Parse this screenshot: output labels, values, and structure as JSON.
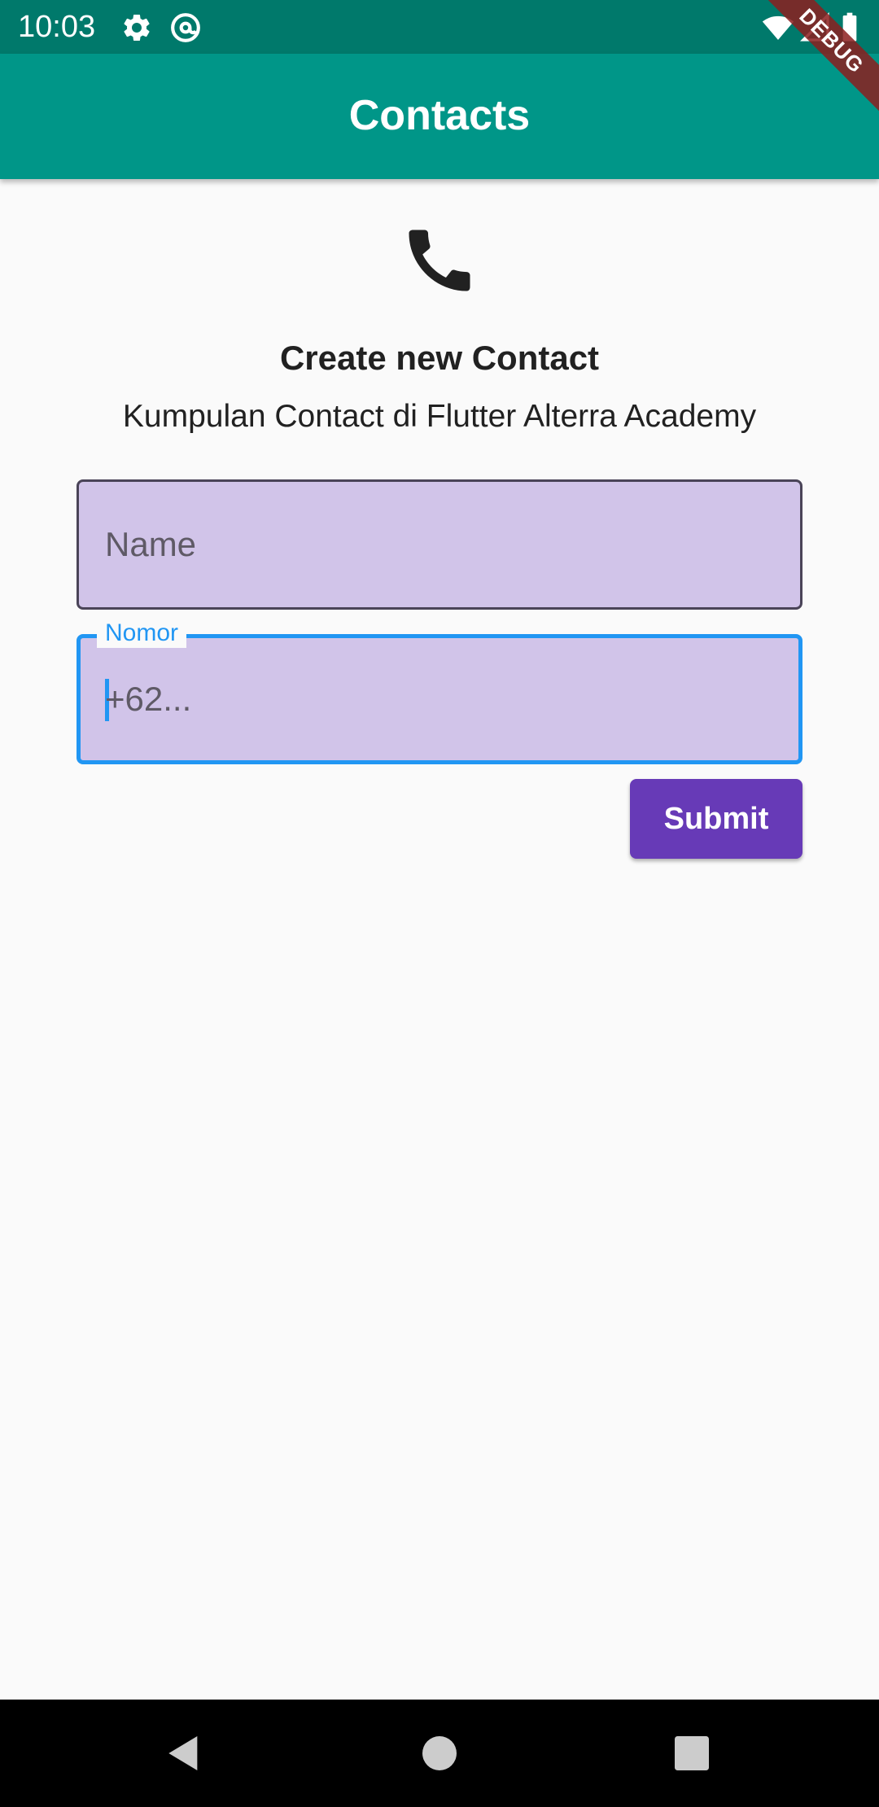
{
  "status_bar": {
    "time": "10:03",
    "icons": [
      "gear-icon",
      "at-sign-icon",
      "wifi-icon",
      "signal-icon",
      "battery-icon"
    ]
  },
  "debug_banner": "DEBUG",
  "app_bar": {
    "title": "Contacts"
  },
  "main": {
    "icon": "phone-icon",
    "heading": "Create new Contact",
    "subheading": "Kumpulan Contact di Flutter Alterra Academy",
    "name_field": {
      "placeholder": "Name",
      "value": ""
    },
    "nomor_field": {
      "label": "Nomor",
      "placeholder": "+62...",
      "value": ""
    },
    "submit_label": "Submit"
  },
  "nav_bar": {
    "buttons": [
      "back-icon",
      "home-icon",
      "recents-icon"
    ]
  },
  "colors": {
    "status_bar": "#00796b",
    "app_bar": "#009688",
    "field_fill": "#d1c4e9",
    "focus_border": "#2196f3",
    "button": "#673ab7"
  }
}
